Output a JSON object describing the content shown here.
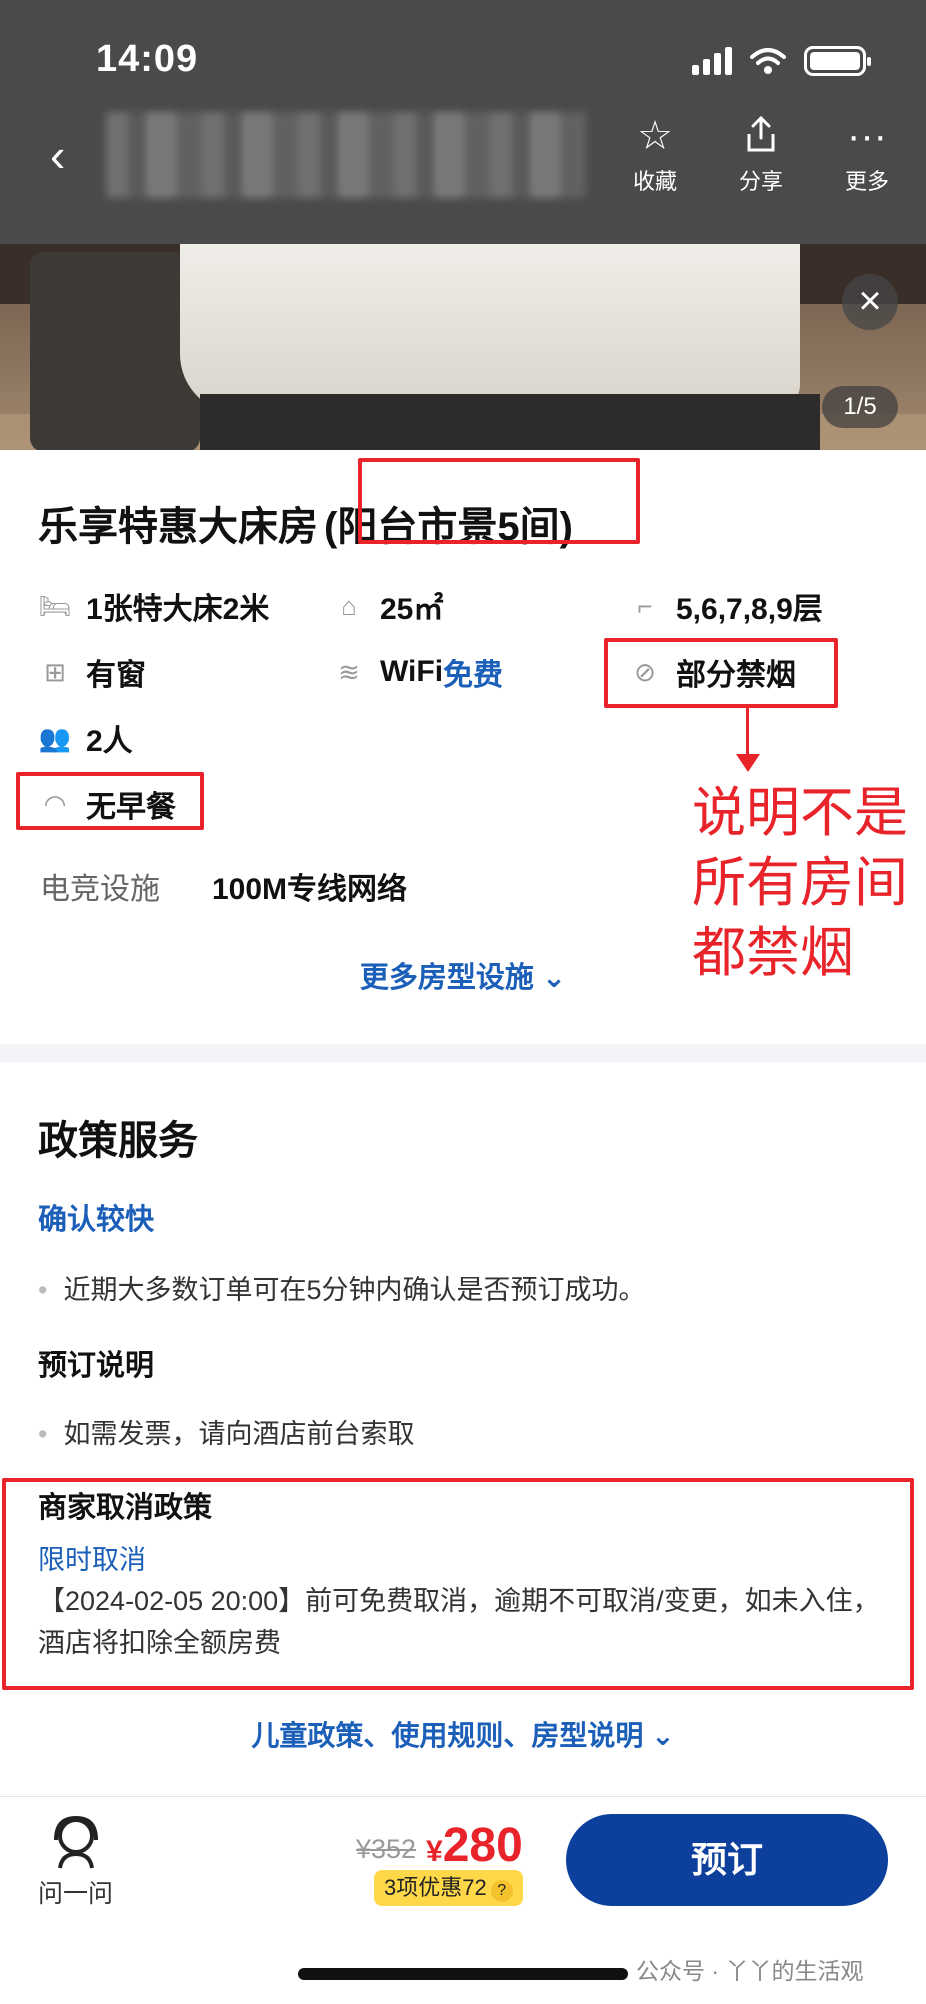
{
  "status_bar": {
    "time": "14:09"
  },
  "nav": {
    "favorite_label": "收藏",
    "share_label": "分享",
    "more_label": "更多"
  },
  "photo": {
    "counter": "1/5"
  },
  "room": {
    "name": "乐享特惠大床房",
    "sub_name": "(阳台市景5间)",
    "facilities": {
      "bed": "1张特大床2米",
      "area": "25㎡",
      "floor": "5,6,7,8,9层",
      "window": "有窗",
      "wifi_prefix": "WiFi",
      "wifi_free": "免费",
      "smoking": "部分禁烟",
      "guests": "2人",
      "breakfast": "无早餐"
    },
    "esports_label": "电竞设施",
    "esports_value": "100M专线网络",
    "more_facilities": "更多房型设施 ⌄"
  },
  "annotation": "说明不是所有房间都禁烟",
  "policy": {
    "heading": "政策服务",
    "confirm_title": "确认较快",
    "confirm_text": "近期大多数订单可在5分钟内确认是否预订成功。",
    "booking_title": "预订说明",
    "booking_text": "如需发票，请向酒店前台索取",
    "cancel_title": "商家取消政策",
    "cancel_type": "限时取消",
    "cancel_text": "【2024-02-05 20:00】前可免费取消，逾期不可取消/变更，如未入住，酒店将扣除全额房费",
    "more_link": "儿童政策、使用规则、房型说明 ⌄"
  },
  "bottom": {
    "ask_label": "问一问",
    "price_old": "¥352",
    "price_currency": "¥",
    "price_now": "280",
    "discount": "3项优惠72",
    "book_label": "预订"
  },
  "watermark": "公众号 · 丫丫的生活观",
  "colors": {
    "accent_blue": "#1b5fb8",
    "button_blue": "#0d3f9c",
    "red": "#e8232a",
    "badge_yellow": "#ffd84a"
  }
}
